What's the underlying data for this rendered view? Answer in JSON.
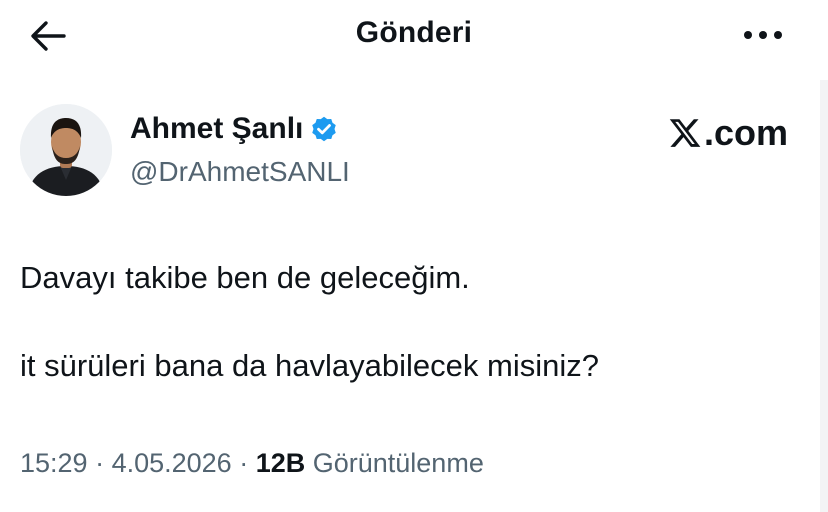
{
  "header": {
    "title": "Gönderi"
  },
  "author": {
    "display_name": "Ahmet Şanlı",
    "handle": "@DrAhmetSANLI",
    "verified": true,
    "badge_color": "#1d9bf0"
  },
  "source": {
    "brand": ".com"
  },
  "tweet": {
    "line1": "Davayı takibe ben de geleceğim.",
    "line2": "it sürüleri bana da havlayabilecek misiniz?"
  },
  "meta": {
    "time": "15:29",
    "sep1": " · ",
    "date": "4.05.2026",
    "sep2": " · ",
    "views_count": "12B",
    "views_label": " Görüntülenme"
  },
  "icons": [
    "back-arrow-icon",
    "more-options-icon",
    "verified-badge-icon",
    "x-logo-icon"
  ]
}
